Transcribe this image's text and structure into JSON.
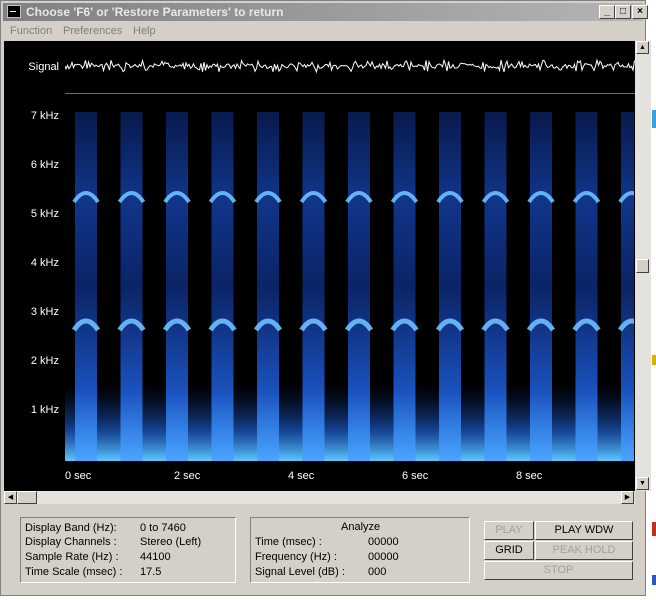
{
  "window": {
    "title": "Choose 'F6' or 'Restore Parameters' to return"
  },
  "menu": [
    "Function",
    "Preferences",
    "Help"
  ],
  "plot": {
    "signal_label": "Signal",
    "freq_labels": [
      "7 kHz",
      "6 kHz",
      "5 kHz",
      "4 kHz",
      "3 kHz",
      "2 kHz",
      "1 kHz"
    ],
    "time_labels": [
      "0  sec",
      "2  sec",
      "4  sec",
      "6  sec",
      "8  sec"
    ]
  },
  "settings": {
    "display_band_label": "Display Band (Hz):",
    "display_band_value": "0 to 7460",
    "display_channels_label": "Display Channels :",
    "display_channels_value": "Stereo (Left)",
    "sample_rate_label": "Sample Rate (Hz) :",
    "sample_rate_value": "44100",
    "time_scale_label": "Time Scale (msec) :",
    "time_scale_value": "17.5"
  },
  "analyze": {
    "heading": "Analyze",
    "time_label": "Time (msec) :",
    "time_value": "00000",
    "frequency_label": "Frequency (Hz) :",
    "frequency_value": "00000",
    "signal_level_label": "Signal Level (dB) :",
    "signal_level_value": "000"
  },
  "buttons": {
    "play": "PLAY",
    "play_wdw": "PLAY WDW",
    "grid": "GRID",
    "peak_hold": "PEAK HOLD",
    "stop": "STOP"
  },
  "colors": {
    "spectrogram": "#2a7fff",
    "signal": "#ffffff",
    "background": "#000000"
  }
}
